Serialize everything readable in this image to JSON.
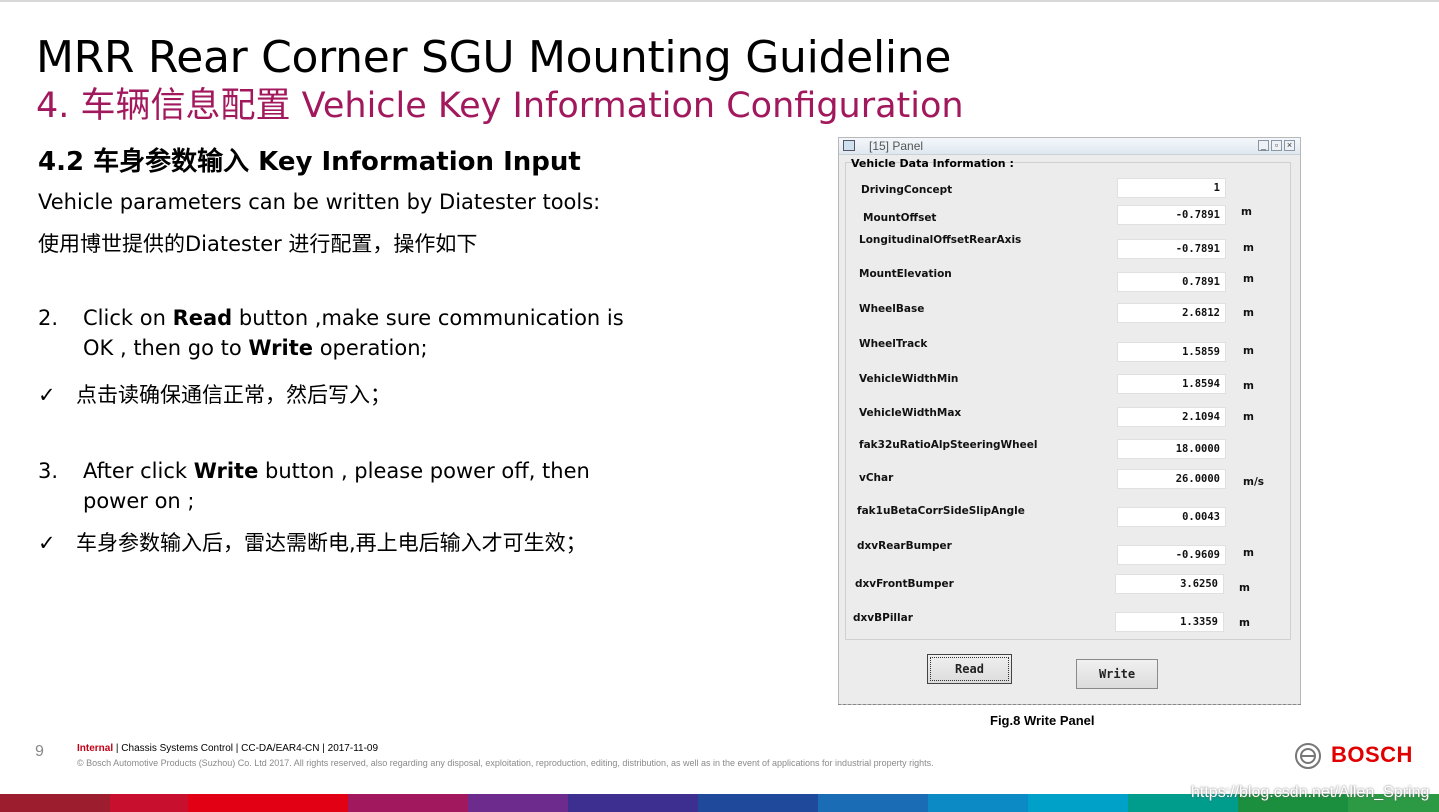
{
  "slide": {
    "title": "MRR Rear Corner SGU Mounting Guideline",
    "subtitle": "4. 车辆信息配置 Vehicle Key Information Configuration",
    "section": "4.2 车身参数输入 Key Information Input",
    "intro_en": "Vehicle parameters can be written by Diatester tools:",
    "intro_cn": "使用博世提供的Diatester 进行配置，操作如下",
    "steps": [
      {
        "num": "2.",
        "pre": "Click on ",
        "bold1": "Read",
        "mid": " button ,make sure communication is OK , then go to ",
        "bold2": "Write",
        "post": " operation;",
        "check_mark": "✓",
        "check_text": "点击读确保通信正常，然后写入；"
      },
      {
        "num": "3.",
        "pre": "After click ",
        "bold1": "Write",
        "post": " button , please power off, then power on ;",
        "check_mark": "✓",
        "check_text": "车身参数输入后，雷达需断电,再上电后输入才可生效；"
      }
    ]
  },
  "panel": {
    "window_title": "[15] Panel",
    "window_buttons": [
      "_",
      "▫",
      "×"
    ],
    "group_title": "Vehicle Data Information :",
    "rows": [
      {
        "label": "DrivingConcept",
        "value": "1",
        "unit": ""
      },
      {
        "label": "MountOffset",
        "value": "-0.7891",
        "unit": "m"
      },
      {
        "label": "LongitudinalOffsetRearAxis",
        "value": "-0.7891",
        "unit": "m"
      },
      {
        "label": "MountElevation",
        "value": "0.7891",
        "unit": "m"
      },
      {
        "label": "WheelBase",
        "value": "2.6812",
        "unit": "m"
      },
      {
        "label": "WheelTrack",
        "value": "1.5859",
        "unit": "m"
      },
      {
        "label": "VehicleWidthMin",
        "value": "1.8594",
        "unit": "m"
      },
      {
        "label": "VehicleWidthMax",
        "value": "2.1094",
        "unit": "m"
      },
      {
        "label": "fak32uRatioAlpSteeringWheel",
        "value": "18.0000",
        "unit": ""
      },
      {
        "label": "vChar",
        "value": "26.0000",
        "unit": "m/s"
      },
      {
        "label": "fak1uBetaCorrSideSlipAngle",
        "value": "0.0043",
        "unit": ""
      },
      {
        "label": "dxvRearBumper",
        "value": "-0.9609",
        "unit": "m"
      },
      {
        "label": "dxvFrontBumper",
        "value": "3.6250",
        "unit": "m"
      },
      {
        "label": "dxvBPillar",
        "value": "1.3359",
        "unit": "m"
      }
    ],
    "read_label": "Read",
    "write_label": "Write",
    "caption": "Fig.8 Write Panel"
  },
  "footer": {
    "page_number": "9",
    "classification": "Internal",
    "info": " | Chassis Systems Control | CC-DA/EAR4-CN | 2017-11-09",
    "copyright": "© Bosch Automotive Products (Suzhou) Co. Ltd 2017. All rights reserved, also regarding any disposal, exploitation, reproduction, editing, distribution, as well as in the event of applications for industrial property rights.",
    "brand": "BOSCH",
    "watermark": "https://blog.csdn.net/Allen_Spring"
  },
  "colors": {
    "accent": "#a2185d",
    "brand_red": "#e00000",
    "bar": [
      "#9b1d2e",
      "#c8102e",
      "#e20015",
      "#a1185e",
      "#6d2b8e",
      "#3c2f8f",
      "#1f4a9c",
      "#1a6cb4",
      "#0c8ac6",
      "#00a1c9",
      "#009c8c",
      "#1b8f3e",
      "#2c9a45"
    ]
  }
}
